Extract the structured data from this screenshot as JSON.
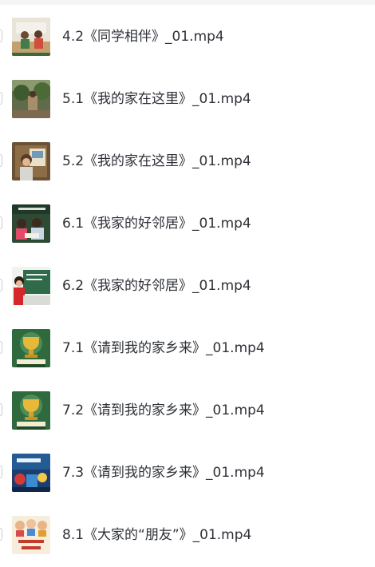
{
  "files": [
    {
      "name": "4.2《同学相伴》_01.mp4",
      "thumbnail": "classroom-students-thumbnail"
    },
    {
      "name": "5.1《我的家在这里》_01.mp4",
      "thumbnail": "garden-home-thumbnail"
    },
    {
      "name": "5.2《我的家在这里》_01.mp4",
      "thumbnail": "child-with-picture-thumbnail"
    },
    {
      "name": "6.1《我家的好邻居》_01.mp4",
      "thumbnail": "neighbors-reading-thumbnail"
    },
    {
      "name": "6.2《我家的好邻居》_01.mp4",
      "thumbnail": "teacher-blackboard-thumbnail"
    },
    {
      "name": "7.1《请到我的家乡来》_01.mp4",
      "thumbnail": "trophy-green-thumbnail"
    },
    {
      "name": "7.2《请到我的家乡来》_01.mp4",
      "thumbnail": "trophy-green-thumbnail"
    },
    {
      "name": "7.3《请到我的家乡来》_01.mp4",
      "thumbnail": "blue-title-card-thumbnail"
    },
    {
      "name": "8.1《大家的“朋友”》_01.mp4",
      "thumbnail": "cartoon-children-thumbnail"
    }
  ]
}
